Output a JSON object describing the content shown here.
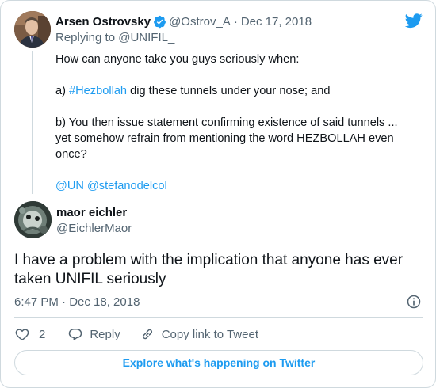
{
  "parent_tweet": {
    "author_name": "Arsen Ostrovsky",
    "handle": "@Ostrov_A",
    "separator": "·",
    "date": "Dec 17, 2018",
    "replying_prefix": "Replying to ",
    "replying_to": "@UNIFIL_",
    "lines": {
      "l1": "How can anyone take you guys seriously when:",
      "l2_prefix": "a) ",
      "l2_hashtag": "#Hezbollah",
      "l2_rest": " dig these tunnels under your nose; and",
      "l3": "b) You then issue statement confirming existence of said tunnels ...",
      "l4": "yet somehow refrain from mentioning the word HEZBOLLAH even",
      "l5": "once?",
      "mention1": "@UN",
      "mention2": "@stefanodelcol"
    }
  },
  "reply_tweet": {
    "author_name": "maor eichler",
    "handle": "@EichlerMaor",
    "text_line1": "I have a problem with the implication that anyone has ever",
    "text_line2": "taken UNIFIL seriously",
    "timestamp": "6:47 PM · Dec 18, 2018"
  },
  "actions": {
    "like_count": "2",
    "reply_label": "Reply",
    "copy_label": "Copy link to Tweet"
  },
  "explore_label": "Explore what's happening on Twitter",
  "colors": {
    "accent": "#1d9bf0",
    "text": "#0f1419",
    "muted": "#536471",
    "border": "#cfd9de"
  }
}
